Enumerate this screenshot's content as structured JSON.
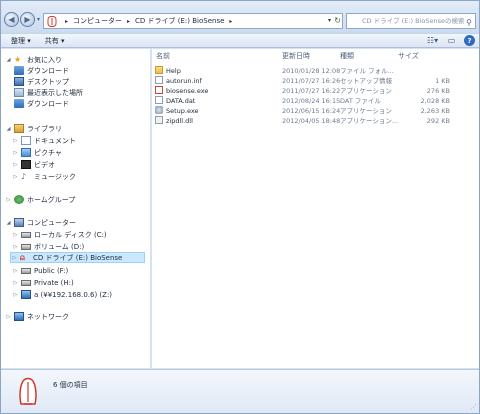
{
  "address": {
    "crumbs": [
      "コンピューター",
      "CD ドライブ (E:) BioSense"
    ],
    "search_placeholder": "CD ドライブ (E:) BioSenseの検索"
  },
  "toolbar": {
    "organize": "整理 ▾",
    "share": "共有 ▾"
  },
  "nav": {
    "favorites": "お気に入り",
    "downloads": "ダウンロード",
    "desktop": "デスクトップ",
    "recent": "最近表示した場所",
    "downloads2": "ダウンロード",
    "libraries": "ライブラリ",
    "documents": "ドキュメント",
    "pictures": "ピクチャ",
    "videos": "ビデオ",
    "music": "ミュージック",
    "homegroup": "ホームグループ",
    "computer": "コンピューター",
    "local_disk": "ローカル ディスク (C:)",
    "volume_d": "ボリューム (D:)",
    "cd_drive": "CD ドライブ (E:) BioSense",
    "public_f": "Public (F:)",
    "private_h": "Private (H:)",
    "net_z": "a (¥¥192.168.0.6) (Z:)",
    "network": "ネットワーク"
  },
  "columns": {
    "name": "名前",
    "date": "更新日時",
    "type": "種類",
    "size": "サイズ"
  },
  "files": [
    {
      "name": "Help",
      "date": "2010/01/28 12:08",
      "type": "ファイル フォル...",
      "size": "",
      "icon": "folder-icon"
    },
    {
      "name": "autorun.inf",
      "date": "2011/07/27 16:26",
      "type": "セットアップ情報",
      "size": "1 KB",
      "icon": "inf-file-icon"
    },
    {
      "name": "biosense.exe",
      "date": "2011/07/27 16:22",
      "type": "アプリケーション",
      "size": "276 KB",
      "icon": "exe-file-icon"
    },
    {
      "name": "DATA.dat",
      "date": "2012/08/24 16:15",
      "type": "DAT ファイル",
      "size": "2,028 KB",
      "icon": "dat-file-icon"
    },
    {
      "name": "Setup.exe",
      "date": "2012/06/15 16:24",
      "type": "アプリケーション",
      "size": "2,263 KB",
      "icon": "setup-exe-icon"
    },
    {
      "name": "zipdll.dll",
      "date": "2012/04/05 18:48",
      "type": "アプリケーション...",
      "size": "292 KB",
      "icon": "dll-file-icon"
    }
  ],
  "details": {
    "item_count": "6 個の項目"
  }
}
